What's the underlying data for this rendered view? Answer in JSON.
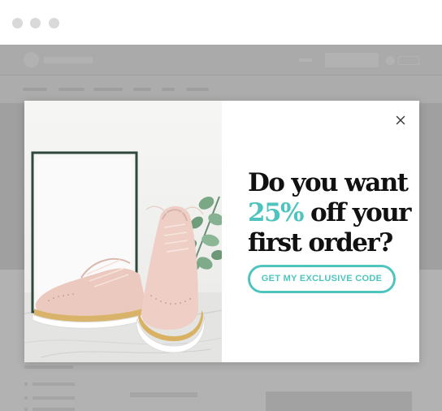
{
  "popup": {
    "headline_line1": "Do you want",
    "headline_accent": "25%",
    "headline_line2_rest": " off your",
    "headline_line3": "first order?",
    "cta_label": "GET MY EXCLUSIVE CODE",
    "close_icon": "close-icon",
    "image_icon": "shoes-photo"
  },
  "colors": {
    "accent": "#4fc4bf",
    "headline_text": "#111111",
    "overlay": "rgba(0,0,0,0.30)"
  }
}
